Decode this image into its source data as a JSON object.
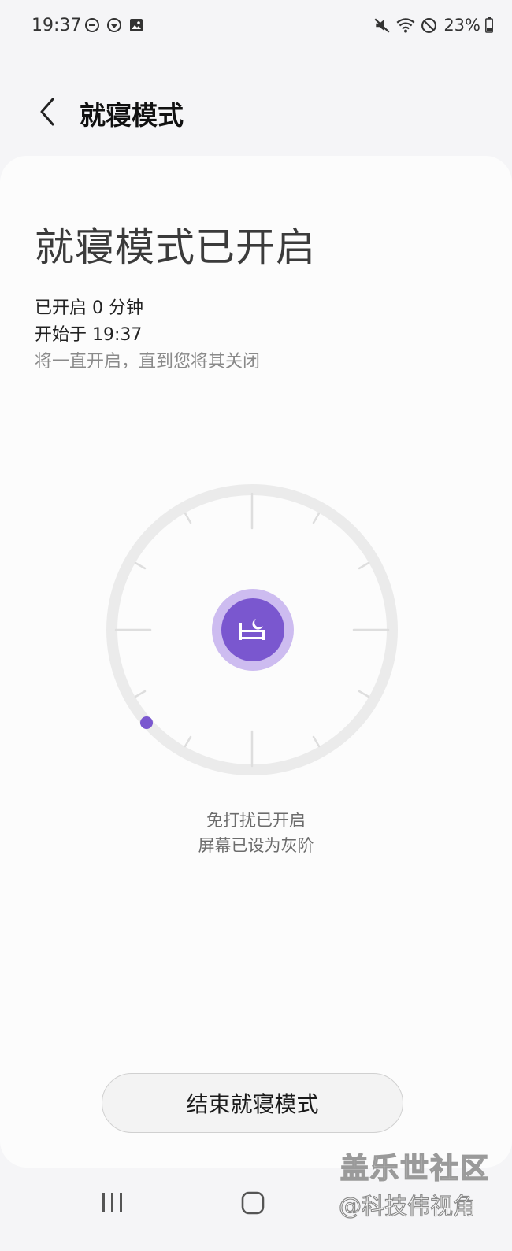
{
  "status_bar": {
    "time": "19:37",
    "battery": "23%"
  },
  "app_bar": {
    "title": "就寝模式"
  },
  "main": {
    "headline": "就寝模式已开启",
    "elapsed": "已开启 0 分钟",
    "started": "开始于 19:37",
    "note": "将一直开启，直到您将其关闭",
    "status_lines": [
      "免打扰已开启",
      "屏幕已设为灰阶"
    ],
    "end_button": "结束就寝模式"
  },
  "colors": {
    "accent": "#7a57cf",
    "accent_light": "#cdbcf0",
    "background": "#f5f5f7",
    "card": "#fcfcfc"
  },
  "icons": {
    "status_left": [
      "do-not-disturb-icon",
      "location-sync-icon",
      "gallery-icon"
    ],
    "status_right": [
      "mute-icon",
      "wifi-icon",
      "block-icon",
      "battery-icon"
    ],
    "center": "bed-moon-icon",
    "nav": [
      "recent-apps-icon",
      "home-icon"
    ]
  },
  "watermark": {
    "main": "盖乐世社区",
    "sub": "@科技伟视角"
  }
}
